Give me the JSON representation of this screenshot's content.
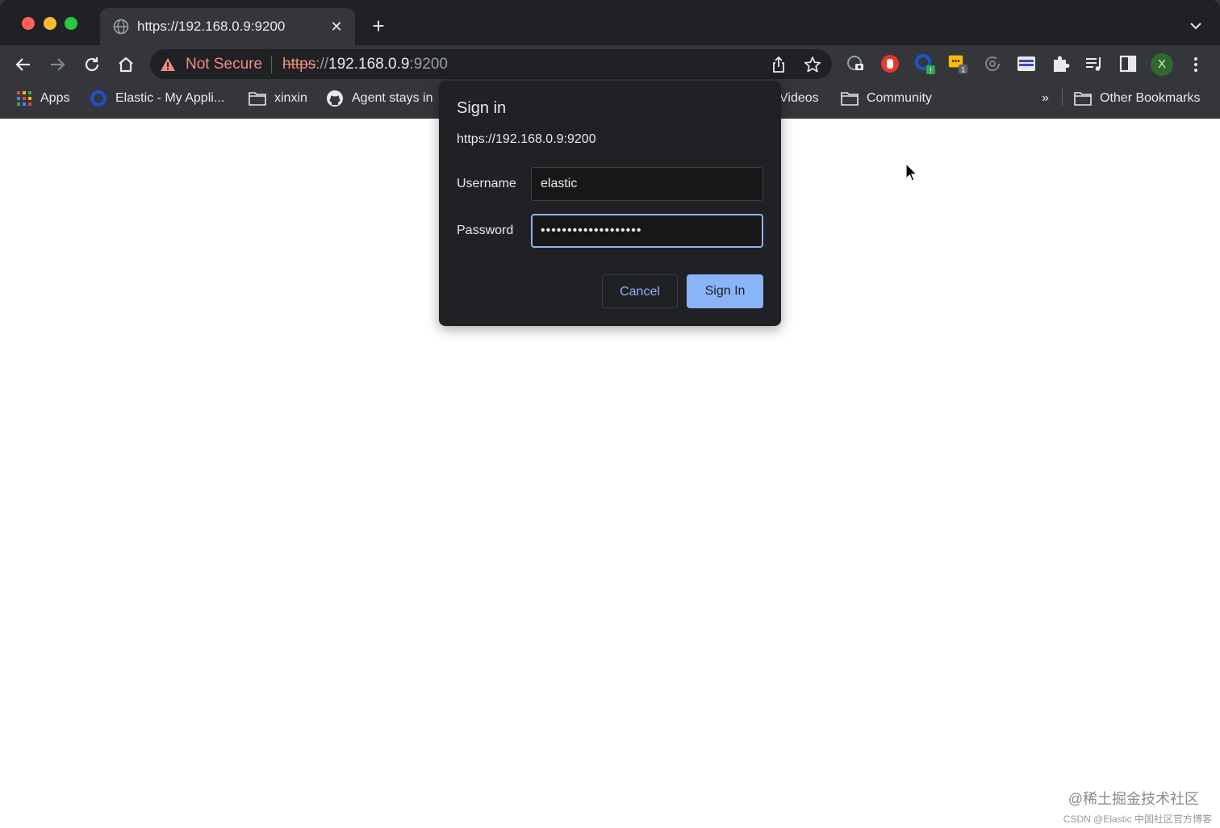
{
  "tab": {
    "title": "https://192.168.0.9:9200",
    "close": "✕",
    "new_tab": "+"
  },
  "omnibox": {
    "security_label": "Not Secure",
    "url_scheme": "https",
    "url_separator": "://",
    "url_host": "192.168.0.9",
    "url_port": ":9200"
  },
  "profile": {
    "initial": "X"
  },
  "extensions": [
    {
      "icon": "screenshot-extension-icon"
    },
    {
      "icon": "stop-hand-extension-icon"
    },
    {
      "icon": "blue-circle-extension-icon",
      "badge": "!"
    },
    {
      "icon": "note-extension-icon",
      "badge": "1"
    },
    {
      "icon": "refresh-extension-icon"
    },
    {
      "icon": "reader-extension-icon"
    },
    {
      "icon": "puzzle-extensions-icon"
    },
    {
      "icon": "media-control-icon"
    },
    {
      "icon": "side-panel-icon"
    }
  ],
  "bookmarks": {
    "apps": "Apps",
    "elastic": "Elastic - My Appli...",
    "xinxin": "xinxin",
    "agent": "Agent stays in",
    "videos": "Videos",
    "community": "Community",
    "overflow": "»",
    "other": "Other Bookmarks"
  },
  "dialog": {
    "title": "Sign in",
    "origin": "https://192.168.0.9:9200",
    "username_label": "Username",
    "username_value": "elastic",
    "password_label": "Password",
    "password_value": "•••••••••••••••••••",
    "cancel_label": "Cancel",
    "signin_label": "Sign In"
  },
  "colors": {
    "accent": "#8ab4f8",
    "not_secure": "#f28b82",
    "chrome_dark": "#35363a",
    "tabstrip": "#202124"
  },
  "watermark": {
    "line1": "@稀土掘金技术社区",
    "line2": "CSDN @Elastic 中国社区官方博客"
  }
}
